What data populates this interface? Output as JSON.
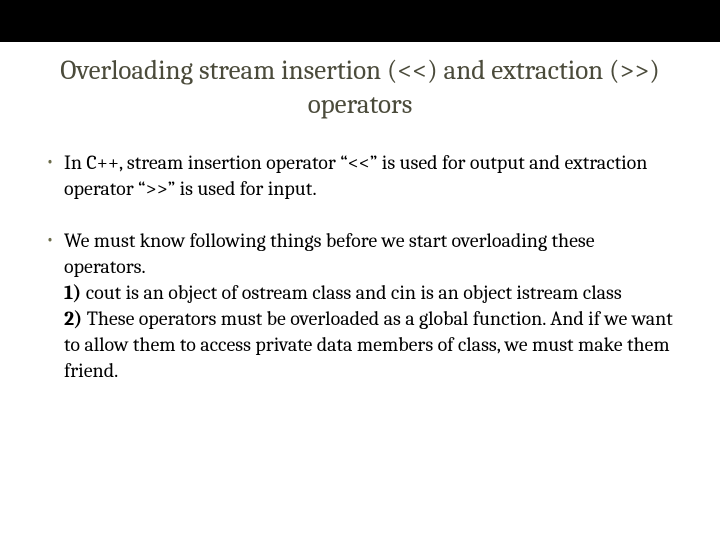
{
  "title": "Overloading stream insertion (<<) and extraction (>>) operators",
  "bullets": [
    {
      "text": "In C++, stream insertion operator “<<” is used for output and extraction operator “>>” is used for input."
    },
    {
      "text": "We must know following things before we start overloading these operators.",
      "sub1_bold": "1)",
      "sub1_rest": " cout is an object of ostream class and cin is an object istream class",
      "sub2_bold": "2)",
      "sub2_rest": " These operators must be overloaded as a global function. And if we want to allow them to access private data members of class, we must make them friend."
    }
  ]
}
